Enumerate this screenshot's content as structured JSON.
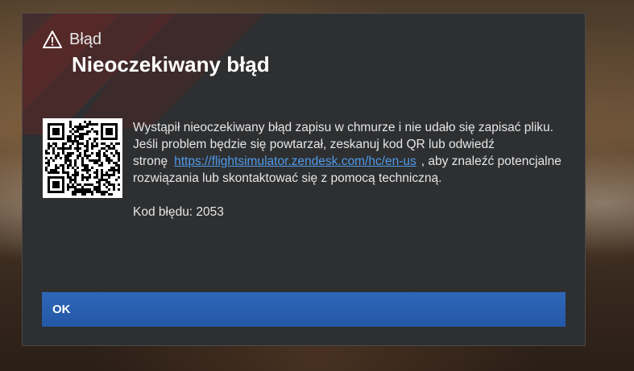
{
  "dialog": {
    "category": "Błąd",
    "title": "Nieoczekiwany błąd",
    "icon": "warning-triangle-icon",
    "message_line1": "Wystąpił nieoczekiwany błąd zapisu w chmurze i nie udało się zapisać pliku.",
    "message_line2_before": "Jeśli problem będzie się powtarzał, zeskanuj kod QR lub odwiedź stronę",
    "link_text": "https://flightsimulator.zendesk.com/hc/en-us",
    "message_line2_after": ", aby znaleźć potencjalne rozwiązania lub skontaktować się z pomocą techniczną.",
    "error_code": "Kod błędu: 2053",
    "ok_label": "OK"
  },
  "colors": {
    "dialog_bg": "#2e2f31",
    "accent_red": "#7a2626",
    "button_blue": "#2a5fb0",
    "link_blue": "#4f9be8"
  }
}
